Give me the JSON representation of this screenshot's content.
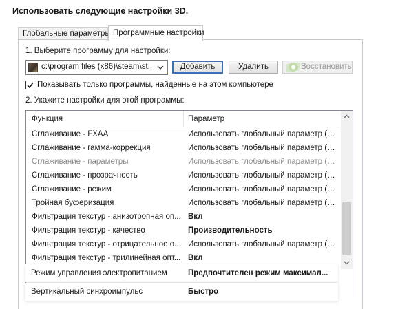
{
  "title": "Использовать следующие настройки 3D.",
  "tabs": [
    {
      "label": "Глобальные параметры"
    },
    {
      "label": "Программные настройки"
    }
  ],
  "program_section": {
    "label": "1. Выберите программу для настройки:",
    "selected_program": "c:\\program files (x86)\\steam\\st...",
    "add_button": "Добавить",
    "remove_button": "Удалить",
    "restore_button": "Восстановить"
  },
  "checkbox": {
    "label": "Показывать только программы, найденные на этом компьютере",
    "checked": true
  },
  "settings_section": {
    "label": "2. Укажите настройки для этой программы:",
    "columns": [
      "Функция",
      "Параметр"
    ],
    "rows": [
      {
        "feature": "Сглаживание - FXAA",
        "value": "Использовать глобальный параметр (В...",
        "style": "normal"
      },
      {
        "feature": "Сглаживание - гамма-коррекция",
        "value": "Использовать глобальный параметр (Вкл)",
        "style": "normal"
      },
      {
        "feature": "Сглаживание - параметры",
        "value": "Использовать глобальный параметр (У...",
        "style": "dim"
      },
      {
        "feature": "Сглаживание - прозрачность",
        "value": "Использовать глобальный параметр (В...",
        "style": "normal"
      },
      {
        "feature": "Сглаживание - режим",
        "value": "Использовать глобальный параметр (У...",
        "style": "normal"
      },
      {
        "feature": "Тройная буферизация",
        "value": "Использовать глобальный параметр (В...",
        "style": "normal"
      },
      {
        "feature": "Фильтрация текстур - анизотропная оп...",
        "value": "Вкл",
        "style": "bold"
      },
      {
        "feature": "Фильтрация текстур - качество",
        "value": "Производительность",
        "style": "bold"
      },
      {
        "feature": "Фильтрация текстур - отрицательное о...",
        "value": "Использовать глобальный параметр (Р...",
        "style": "normal"
      },
      {
        "feature": "Фильтрация текстур - трилинейная опт...",
        "value": "Вкл",
        "style": "bold"
      }
    ],
    "highlighted_rows": [
      {
        "feature": "Режим управления электропитанием",
        "value": "Предпочтителен режим максимал..."
      },
      {
        "feature": "Вертикальный синхроимпульс",
        "value": "Быстро"
      }
    ]
  },
  "colors": {
    "accent_border": "#3b6fb6",
    "dim_text": "#8c8c8c",
    "nvidia_green": "#76b900"
  }
}
